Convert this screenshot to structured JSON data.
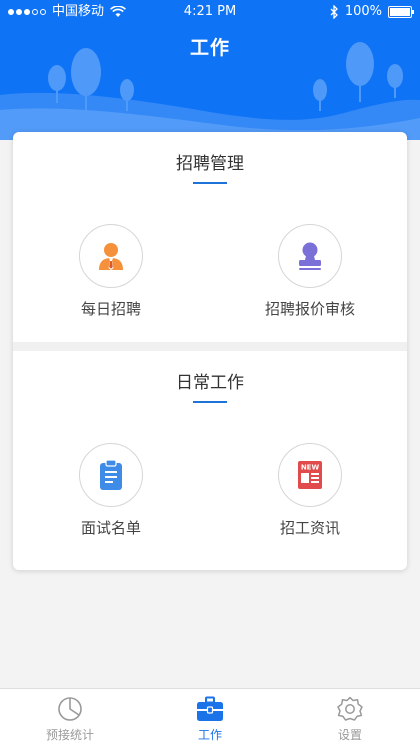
{
  "status_bar": {
    "carrier": "中国移动",
    "time": "4:21 PM",
    "battery": "100%"
  },
  "page": {
    "title": "工作"
  },
  "sections": [
    {
      "title": "招聘管理",
      "items": [
        {
          "label": "每日招聘",
          "icon": "recruiter-person-icon"
        },
        {
          "label": "招聘报价审核",
          "icon": "stamp-icon"
        }
      ]
    },
    {
      "title": "日常工作",
      "items": [
        {
          "label": "面试名单",
          "icon": "clipboard-icon"
        },
        {
          "label": "招工资讯",
          "icon": "news-icon",
          "icon_text": "NEW"
        }
      ]
    }
  ],
  "tabs": [
    {
      "label": "预接统计",
      "icon": "pie-chart-icon",
      "active": false
    },
    {
      "label": "工作",
      "icon": "briefcase-icon",
      "active": true
    },
    {
      "label": "设置",
      "icon": "gear-icon",
      "active": false
    }
  ],
  "colors": {
    "header": "#0f73f6",
    "accent": "#1a73e8",
    "orange": "#f4913a",
    "purple": "#7b6fd8",
    "blue_icon": "#3f8be8",
    "red_icon": "#e24b4b"
  }
}
